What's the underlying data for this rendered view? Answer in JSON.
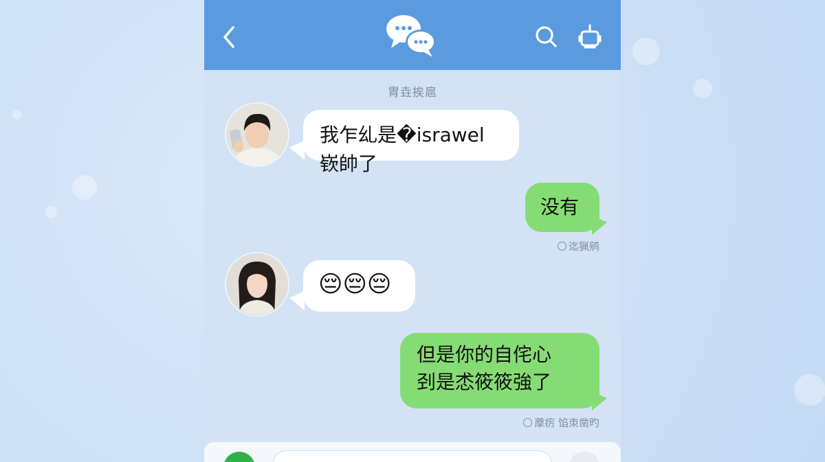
{
  "header": {
    "back_icon": "chevron-left-icon",
    "logo_icon": "chat-bubbles-icon",
    "search_icon": "search-icon",
    "robot_icon": "robot-icon",
    "color": "#5a9be0"
  },
  "chat": {
    "timestamp": "胄垚挨扈",
    "messages": [
      {
        "side": "in",
        "avatar": "male-avatar",
        "text": "我乍乣是�israwel嵚帥了"
      },
      {
        "side": "out",
        "text": "没有",
        "status": "迄猟鹓"
      },
      {
        "side": "in",
        "avatar": "female-avatar",
        "emojis": [
          "😔",
          "😔",
          "😔"
        ]
      },
      {
        "side": "out",
        "line1": "但是你的自侘心",
        "line2": "刭是怸筱筱強了",
        "status": "藦疠  馅朿凿旳"
      }
    ]
  },
  "colors": {
    "incoming": "#ffffff",
    "outgoing": "#86dc74",
    "background": "#d3e3f5"
  }
}
